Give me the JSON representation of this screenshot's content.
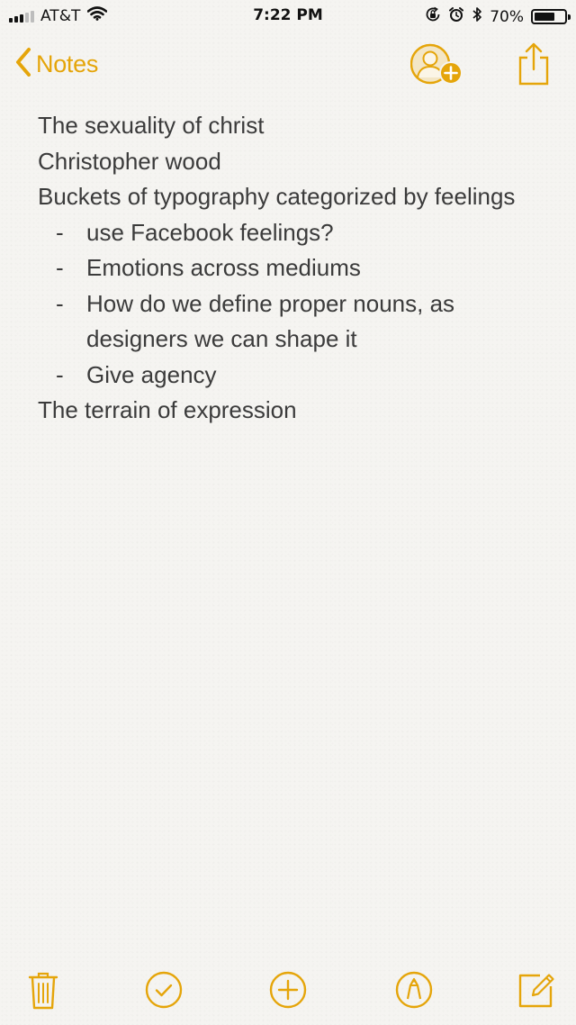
{
  "status_bar": {
    "carrier": "AT&T",
    "time": "7:22 PM",
    "battery_text": "70%",
    "battery_level": 0.7,
    "signal_bars_filled": 3,
    "signal_bars_total": 5
  },
  "nav": {
    "back_label": "Notes",
    "accent_color": "#e5a50a"
  },
  "note": {
    "lines": [
      "The sexuality of christ",
      "Christopher wood",
      "Buckets of typography categorized by feelings"
    ],
    "bullet_marker": "-",
    "bullets": [
      "use Facebook feelings?",
      "Emotions across mediums",
      "How do we define proper nouns, as designers we can shape it",
      "Give agency"
    ],
    "closing_line": "The terrain of expression"
  },
  "toolbar": {
    "icons": [
      "trash-icon",
      "checklist-icon",
      "add-icon",
      "markup-icon",
      "compose-icon"
    ]
  }
}
